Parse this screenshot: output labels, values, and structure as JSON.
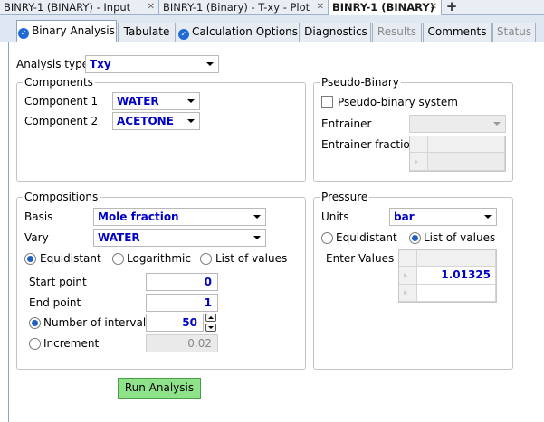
{
  "doc_tabs": [
    {
      "label": "BINRY-1 (BINARY) - Input"
    },
    {
      "label": "BINRY-1 (Binary) - T-xy - Plot"
    },
    {
      "label": "BINRY-1 (BINARY)"
    }
  ],
  "form_tabs": [
    {
      "label": "Binary Analysis",
      "state": "active",
      "icon": "check-circle-icon"
    },
    {
      "label": "Tabulate",
      "state": "normal"
    },
    {
      "label": "Calculation Options",
      "state": "normal",
      "icon": "check-circle-icon"
    },
    {
      "label": "Diagnostics",
      "state": "normal"
    },
    {
      "label": "Results",
      "state": "disabled"
    },
    {
      "label": "Comments",
      "state": "normal"
    },
    {
      "label": "Status",
      "state": "disabled"
    }
  ],
  "analysis_type": {
    "label": "Analysis type",
    "value": "Txy"
  },
  "components": {
    "title": "Components",
    "comp1_label": "Component 1",
    "comp1_value": "WATER",
    "comp2_label": "Component 2",
    "comp2_value": "ACETONE"
  },
  "pseudo": {
    "title": "Pseudo-Binary",
    "checkbox_label": "Pseudo-binary system",
    "checked": false,
    "entrainer_label": "Entrainer",
    "entrainer_fraction_label": "Entrainer fraction"
  },
  "compositions": {
    "title": "Compositions",
    "basis_label": "Basis",
    "basis_value": "Mole fraction",
    "vary_label": "Vary",
    "vary_value": "WATER",
    "options": [
      "Equidistant",
      "Logarithmic",
      "List of values"
    ],
    "selected_option": "Equidistant",
    "start_label": "Start point",
    "start_value": "0",
    "end_label": "End point",
    "end_value": "1",
    "intervals_label": "Number of intervals",
    "intervals_value": "50",
    "increment_label": "Increment",
    "increment_value": "0.02",
    "selected_mode": "Number of intervals"
  },
  "pressure": {
    "title": "Pressure",
    "units_label": "Units",
    "units_value": "bar",
    "options": [
      "Equidistant",
      "List of values"
    ],
    "selected_option": "List of values",
    "enter_values_label": "Enter Values",
    "values": [
      "1.01325"
    ]
  },
  "run_button": {
    "label": "Run Analysis",
    "color": "#8ee38a"
  },
  "accent_color": "#1e6ad6"
}
